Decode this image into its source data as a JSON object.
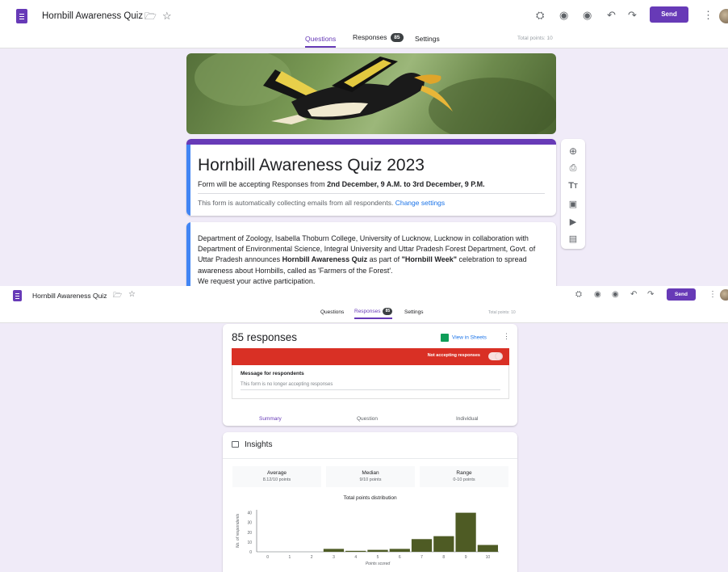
{
  "header": {
    "title": "Hornbill Awareness Quiz",
    "send_label": "Send"
  },
  "tabs": {
    "questions": "Questions",
    "responses": "Responses",
    "responses_count": "85",
    "settings": "Settings",
    "total_points": "Total points: 10"
  },
  "form": {
    "title": "Hornbill Awareness Quiz 2023",
    "accepting_prefix": "Form will be accepting Responses from ",
    "accepting_bold": "2nd December, 9 A.M. to 3rd December, 9 P.M.",
    "email_note": "This form is automatically collecting emails from all respondents.",
    "change_settings": "Change settings",
    "desc_part1": "Department of Zoology, Isabella Thoburn College, University of Lucknow, Lucknow in collaboration with Department of Environmental Science, Integral University and Uttar Pradesh Forest Department, Govt. of Uttar Pradesh announces ",
    "desc_bold1": "Hornbill Awareness Quiz",
    "desc_part2": " as part of ",
    "desc_bold2": "\"Hornbill Week\"",
    "desc_part3": " celebration to spread awareness about Hornbills, called as 'Farmers of the Forest'.",
    "desc_line2": "We request your active participation."
  },
  "responses": {
    "title": "85 responses",
    "view_sheets": "View in Sheets",
    "not_accepting": "Not accepting responses",
    "message_heading": "Message for respondents",
    "message_value": "This form is no longer accepting responses",
    "subtabs": {
      "summary": "Summary",
      "question": "Question",
      "individual": "Individual"
    }
  },
  "insights": {
    "title": "Insights",
    "average_label": "Average",
    "average_value": "8.12/10 points",
    "median_label": "Median",
    "median_value": "9/10 points",
    "range_label": "Range",
    "range_value": "0-10 points"
  },
  "colors": {
    "brand": "#673ab7",
    "accent_blue": "#4285f4",
    "alert_red": "#d93025",
    "bar_fill": "#4e5b24"
  },
  "chart_data": {
    "type": "bar",
    "title": "Total points distribution",
    "xlabel": "Points scored",
    "ylabel": "No. of respondents",
    "categories": [
      "0",
      "1",
      "2",
      "3",
      "4",
      "5",
      "6",
      "7",
      "8",
      "9",
      "10"
    ],
    "values": [
      0,
      0,
      0,
      3,
      1,
      2,
      3,
      13,
      16,
      40,
      7
    ],
    "yticks": [
      0,
      10,
      20,
      30,
      40
    ],
    "ylim": [
      0,
      43
    ]
  }
}
